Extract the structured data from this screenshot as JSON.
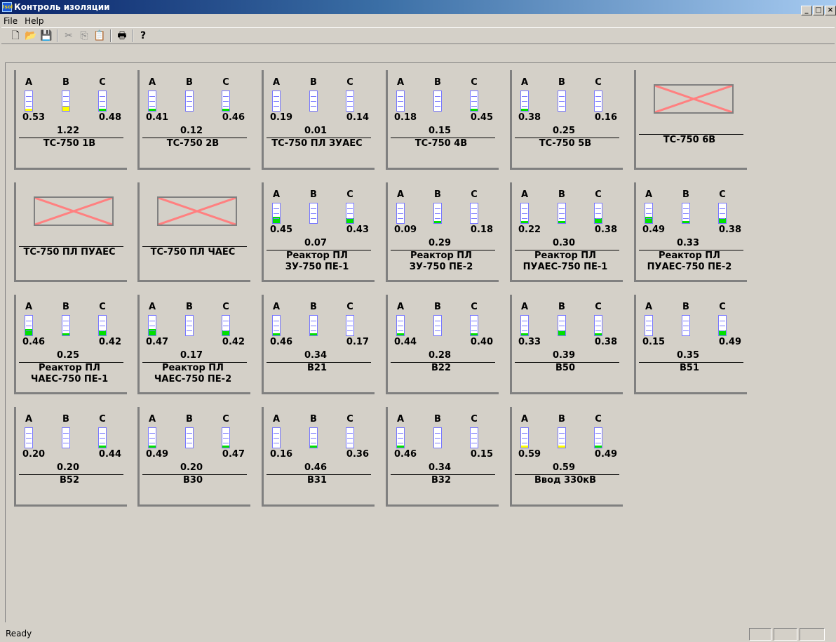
{
  "window": {
    "title": "Контроль изоляции",
    "icon_text": "Isol",
    "controls": [
      "_",
      "□",
      "×"
    ]
  },
  "menu": {
    "file": "File",
    "help": "Help"
  },
  "toolbar": {
    "buttons": [
      "new-icon",
      "open-icon",
      "save-icon",
      "cut-icon",
      "copy-icon",
      "paste-icon",
      "print-icon",
      "help-icon"
    ]
  },
  "colors": {
    "green": "#00e000",
    "yellow": "#ffff00",
    "offline_cross": "#ff8080"
  },
  "phase_labels": {
    "a": "A",
    "b": "B",
    "c": "C"
  },
  "panels": [
    {
      "name": "ТС-750 1В",
      "a": "0.53",
      "c": "0.48",
      "sum": "1.22",
      "fa": 0.12,
      "fb": 0.25,
      "fc": 0.12,
      "ca": "yellow",
      "cb": "yellow",
      "cc": "green"
    },
    {
      "name": "ТС-750 2В",
      "a": "0.41",
      "c": "0.46",
      "sum": "0.12",
      "fa": 0.12,
      "fb": 0.0,
      "fc": 0.12,
      "ca": "green",
      "cb": "green",
      "cc": "green"
    },
    {
      "name": "ТС-750 ПЛ ЗУАЕС",
      "a": "0.19",
      "c": "0.14",
      "sum": "0.01",
      "fa": 0.0,
      "fb": 0.0,
      "fc": 0.0,
      "ca": "green",
      "cb": "green",
      "cc": "green"
    },
    {
      "name": "ТС-750 4В",
      "a": "0.18",
      "c": "0.45",
      "sum": "0.15",
      "fa": 0.0,
      "fb": 0.0,
      "fc": 0.12,
      "ca": "green",
      "cb": "green",
      "cc": "green"
    },
    {
      "name": "ТС-750 5В",
      "a": "0.38",
      "c": "0.16",
      "sum": "0.25",
      "fa": 0.12,
      "fb": 0.0,
      "fc": 0.0,
      "ca": "green",
      "cb": "green",
      "cc": "green"
    },
    {
      "name": "ТС-750 6В",
      "offline": true
    },
    {
      "name": "ТС-750 ПЛ ПУАЕС",
      "offline": true
    },
    {
      "name": "ТС-750 ПЛ ЧАЕС",
      "offline": true
    },
    {
      "name": "Реактор ПЛ\nЗУ-750 ПЕ-1",
      "a": "0.45",
      "c": "0.43",
      "sum": "0.07",
      "fa": 0.33,
      "fb": 0.0,
      "fc": 0.25,
      "ca": "green",
      "cb": "green",
      "cc": "green"
    },
    {
      "name": "Реактор ПЛ\nЗУ-750 ПЕ-2",
      "a": "0.09",
      "c": "0.18",
      "sum": "0.29",
      "fa": 0.0,
      "fb": 0.12,
      "fc": 0.0,
      "ca": "green",
      "cb": "green",
      "cc": "green"
    },
    {
      "name": "Реактор ПЛ\nПУАЕС-750 ПЕ-1",
      "a": "0.22",
      "c": "0.38",
      "sum": "0.30",
      "fa": 0.12,
      "fb": 0.12,
      "fc": 0.25,
      "ca": "green",
      "cb": "green",
      "cc": "green"
    },
    {
      "name": "Реактор ПЛ\nПУАЕС-750 ПЕ-2",
      "a": "0.49",
      "c": "0.38",
      "sum": "0.33",
      "fa": 0.33,
      "fb": 0.12,
      "fc": 0.25,
      "ca": "green",
      "cb": "green",
      "cc": "green"
    },
    {
      "name": "Реактор ПЛ\nЧАЕС-750 ПЕ-1",
      "a": "0.46",
      "c": "0.42",
      "sum": "0.25",
      "fa": 0.33,
      "fb": 0.12,
      "fc": 0.25,
      "ca": "green",
      "cb": "green",
      "cc": "green"
    },
    {
      "name": "Реактор ПЛ\nЧАЕС-750 ПЕ-2",
      "a": "0.47",
      "c": "0.42",
      "sum": "0.17",
      "fa": 0.33,
      "fb": 0.0,
      "fc": 0.25,
      "ca": "green",
      "cb": "green",
      "cc": "green"
    },
    {
      "name": "B21",
      "a": "0.46",
      "c": "0.17",
      "sum": "0.34",
      "fa": 0.12,
      "fb": 0.12,
      "fc": 0.0,
      "ca": "green",
      "cb": "green",
      "cc": "green"
    },
    {
      "name": "B22",
      "a": "0.44",
      "c": "0.40",
      "sum": "0.28",
      "fa": 0.12,
      "fb": 0.0,
      "fc": 0.12,
      "ca": "green",
      "cb": "green",
      "cc": "green"
    },
    {
      "name": "B50",
      "a": "0.33",
      "c": "0.38",
      "sum": "0.39",
      "fa": 0.12,
      "fb": 0.25,
      "fc": 0.12,
      "ca": "green",
      "cb": "green",
      "cc": "green"
    },
    {
      "name": "B51",
      "a": "0.15",
      "c": "0.49",
      "sum": "0.35",
      "fa": 0.0,
      "fb": 0.0,
      "fc": 0.25,
      "ca": "green",
      "cb": "green",
      "cc": "green"
    },
    {
      "name": "B52",
      "a": "0.20",
      "c": "0.44",
      "sum": "0.20",
      "fa": 0.0,
      "fb": 0.0,
      "fc": 0.12,
      "ca": "green",
      "cb": "green",
      "cc": "green"
    },
    {
      "name": "B30",
      "a": "0.49",
      "c": "0.47",
      "sum": "0.20",
      "fa": 0.12,
      "fb": 0.0,
      "fc": 0.12,
      "ca": "green",
      "cb": "green",
      "cc": "green"
    },
    {
      "name": "B31",
      "a": "0.16",
      "c": "0.36",
      "sum": "0.46",
      "fa": 0.0,
      "fb": 0.12,
      "fc": 0.0,
      "ca": "green",
      "cb": "green",
      "cc": "green"
    },
    {
      "name": "B32",
      "a": "0.46",
      "c": "0.15",
      "sum": "0.34",
      "fa": 0.12,
      "fb": 0.0,
      "fc": 0.0,
      "ca": "green",
      "cb": "green",
      "cc": "green"
    },
    {
      "name": "Ввод 330кВ",
      "a": "0.59",
      "c": "0.49",
      "sum": "0.59",
      "fa": 0.12,
      "fb": 0.12,
      "fc": 0.12,
      "ca": "yellow",
      "cb": "yellow",
      "cc": "green"
    }
  ],
  "status": {
    "text": "Ready"
  }
}
